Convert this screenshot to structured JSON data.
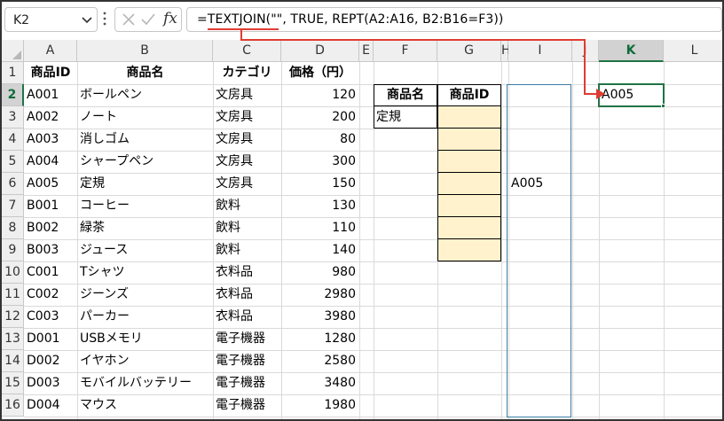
{
  "name_box": {
    "value": "K2"
  },
  "formula_bar": {
    "fx_label": "fx",
    "formula": "=TEXTJOIN(\"\", TRUE, REPT(A2:A16, B2:B16=F3))"
  },
  "columns": [
    "A",
    "B",
    "C",
    "D",
    "E",
    "F",
    "G",
    "H",
    "I",
    "J",
    "K",
    "L"
  ],
  "rows": [
    "1",
    "2",
    "3",
    "4",
    "5",
    "6",
    "7",
    "8",
    "9",
    "10",
    "11",
    "12",
    "13",
    "14",
    "15",
    "16"
  ],
  "headers": {
    "a": "商品ID",
    "b": "商品名",
    "c": "カテゴリ",
    "d": "価格（円）"
  },
  "products": [
    {
      "id": "A001",
      "name": "ボールペン",
      "category": "文房具",
      "price": "120"
    },
    {
      "id": "A002",
      "name": "ノート",
      "category": "文房具",
      "price": "200"
    },
    {
      "id": "A003",
      "name": "消しゴム",
      "category": "文房具",
      "price": "80"
    },
    {
      "id": "A004",
      "name": "シャープペン",
      "category": "文房具",
      "price": "300"
    },
    {
      "id": "A005",
      "name": "定規",
      "category": "文房具",
      "price": "150"
    },
    {
      "id": "B001",
      "name": "コーヒー",
      "category": "飲料",
      "price": "130"
    },
    {
      "id": "B002",
      "name": "緑茶",
      "category": "飲料",
      "price": "110"
    },
    {
      "id": "B003",
      "name": "ジュース",
      "category": "飲料",
      "price": "140"
    },
    {
      "id": "C001",
      "name": "Tシャツ",
      "category": "衣料品",
      "price": "980"
    },
    {
      "id": "C002",
      "name": "ジーンズ",
      "category": "衣料品",
      "price": "2980"
    },
    {
      "id": "C003",
      "name": "パーカー",
      "category": "衣料品",
      "price": "3980"
    },
    {
      "id": "D001",
      "name": "USBメモリ",
      "category": "電子機器",
      "price": "1280"
    },
    {
      "id": "D002",
      "name": "イヤホン",
      "category": "電子機器",
      "price": "2580"
    },
    {
      "id": "D003",
      "name": "モバイルバッテリー",
      "category": "電子機器",
      "price": "3480"
    },
    {
      "id": "D004",
      "name": "マウス",
      "category": "電子機器",
      "price": "1980"
    }
  ],
  "lookup": {
    "f_header": "商品名",
    "g_header": "商品ID",
    "f3": "定規"
  },
  "result_i6": "A005",
  "result_k2": "A005",
  "colors": {
    "accent": "#217346",
    "arrow": "#e03c31",
    "fill": "#fff2cc",
    "blue_box": "#3a7ca5"
  }
}
